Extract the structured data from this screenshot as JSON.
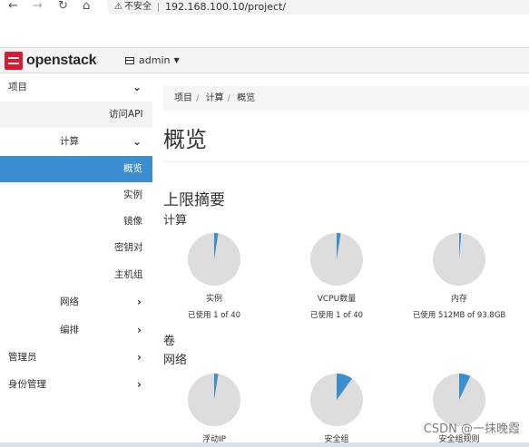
{
  "browser": {
    "back_icon": "arrow-left-icon",
    "forward_icon": "arrow-right-icon",
    "reload_icon": "reload-icon",
    "home_icon": "home-icon",
    "security_label": "不安全",
    "url": "192.168.100.10/project/"
  },
  "topnav": {
    "logo_text": "openstack",
    "project": "admin"
  },
  "sidebar": {
    "items": [
      {
        "label": "项目"
      },
      {
        "label": "访问API"
      },
      {
        "label": "计算"
      },
      {
        "label": "概览"
      },
      {
        "label": "实例"
      },
      {
        "label": "镜像"
      },
      {
        "label": "密钥对"
      },
      {
        "label": "主机组"
      },
      {
        "label": "网络"
      },
      {
        "label": "编排"
      },
      {
        "label": "管理员"
      },
      {
        "label": "身份管理"
      }
    ]
  },
  "breadcrumb": [
    "项目",
    "计算",
    "概览"
  ],
  "page_title": "概览",
  "limits_title": "上限摘要",
  "sections": {
    "compute": "计算",
    "volume": "卷",
    "network": "网络"
  },
  "pies": [
    {
      "label": "实例",
      "sub": "已使用 1 of 40",
      "fraction": 0.025
    },
    {
      "label": "VCPU数量",
      "sub": "已使用 1 of 40",
      "fraction": 0.025
    },
    {
      "label": "内存",
      "sub": "已使用 512MB of 93.8GB",
      "fraction": 0.012
    },
    {
      "label": "浮动IP",
      "sub": "",
      "fraction": 0.025
    },
    {
      "label": "安全组",
      "sub": "",
      "fraction": 0.1
    },
    {
      "label": "安全组规则",
      "sub": "",
      "fraction": 0.07
    }
  ],
  "colors": {
    "accent": "#3b8ed0",
    "pie_bg": "#dddddd",
    "pie_fill": "#3b8ed0",
    "logo_red": "#da1a32"
  },
  "watermark": "CSDN @一抹晚霞"
}
